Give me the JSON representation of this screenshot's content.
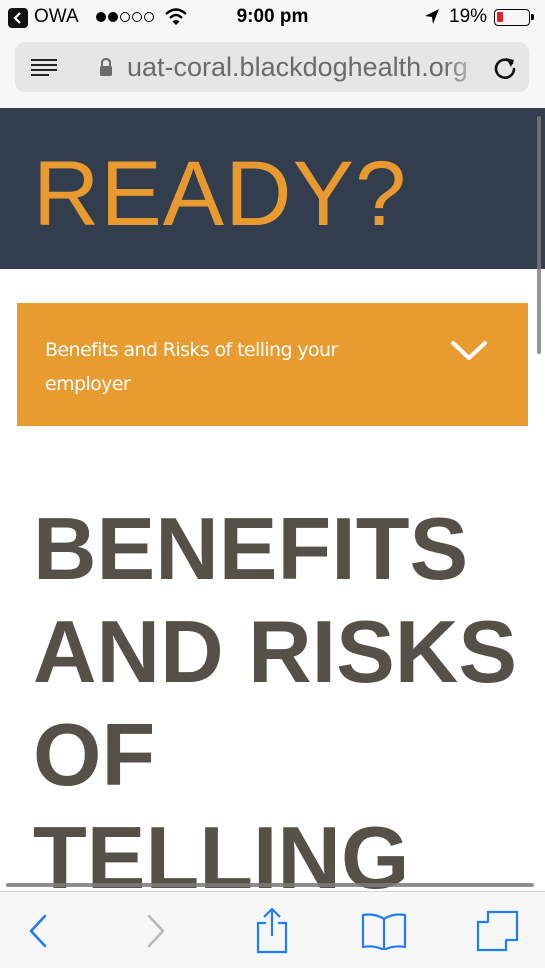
{
  "status_bar": {
    "back_app": "OWA",
    "time": "9:00 pm",
    "battery_percent": "19%",
    "battery_level": 0.19,
    "signal_dots_filled": 2,
    "signal_dots_total": 5
  },
  "browser": {
    "url": "uat-coral.blackdoghealth.org"
  },
  "hero": {
    "title": "READY?"
  },
  "accordion": {
    "label": "Benefits and Risks of telling your employer"
  },
  "article": {
    "heading": "BENEFITS AND RISKS OF TELLING"
  },
  "icons": {
    "back": "chevron-left-icon",
    "forward": "chevron-right-icon",
    "share": "share-icon",
    "bookmarks": "book-icon",
    "tabs": "tabs-icon",
    "reader": "reader-icon",
    "lock": "lock-icon",
    "reload": "reload-icon"
  },
  "colors": {
    "hero_bg": "#323d4d",
    "accent": "#e89b2f",
    "heading_text": "#555148",
    "toolbar_tint": "#1f7ef5"
  }
}
